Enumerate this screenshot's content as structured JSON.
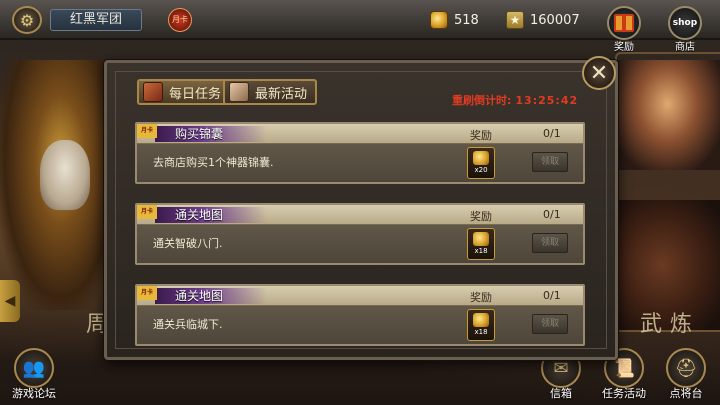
{
  "topbar": {
    "guild_name": "红黑军团",
    "month_card_label": "月卡",
    "gold": "518",
    "stars": "160007",
    "gift_label": "奖励",
    "shop_icon_text": "shop",
    "shop_label": "商店"
  },
  "background": {
    "left_text": "周",
    "right_text": "武炼"
  },
  "modal": {
    "tabs": [
      {
        "label": "每日任务",
        "active": true
      },
      {
        "label": "最新活动",
        "active": false
      }
    ],
    "timer_label": "重刷倒计时:",
    "timer_value": "13:25:42",
    "tasks": [
      {
        "flag": "月卡",
        "title": "购买锦囊",
        "description": "去商店购买1个神器锦囊.",
        "reward_label": "奖励",
        "progress": "0/1",
        "reward_qty": "x20",
        "claim_label": "领取"
      },
      {
        "flag": "月卡",
        "title": "通关地图",
        "description": "通关智破八门.",
        "reward_label": "奖励",
        "progress": "0/1",
        "reward_qty": "x18",
        "claim_label": "领取"
      },
      {
        "flag": "月卡",
        "title": "通关地图",
        "description": "通关兵临城下.",
        "reward_label": "奖励",
        "progress": "0/1",
        "reward_qty": "x18",
        "claim_label": "领取"
      }
    ]
  },
  "bottom": {
    "forum_label": "游戏论坛",
    "mail_label": "信箱",
    "tasks_label": "任务活动",
    "general_label": "点将台"
  },
  "colors": {
    "timer_red": "#e03a22",
    "gold_border": "#a8884a",
    "title_purple": "#6a3a8a"
  }
}
